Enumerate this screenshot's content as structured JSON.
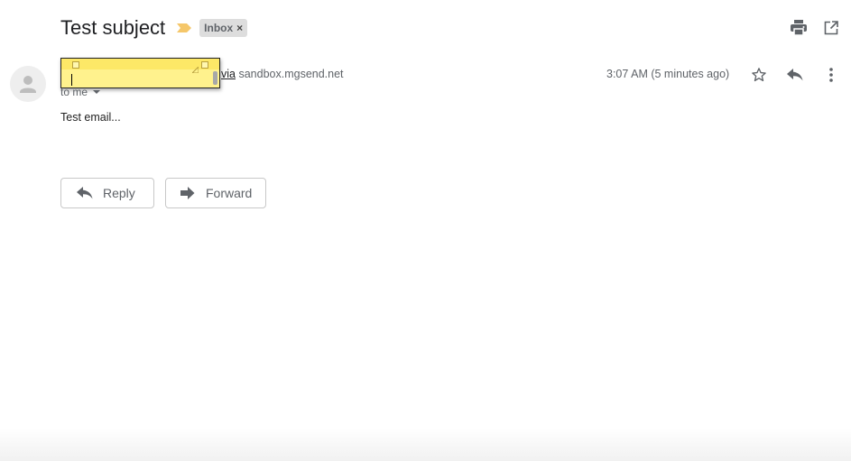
{
  "subject": {
    "title": "Test subject",
    "label": "Inbox",
    "label_remove": "×"
  },
  "toolbar": {
    "print_icon": "print-icon",
    "open_new_window_icon": "open-in-new-icon"
  },
  "sender": {
    "via_word": "via",
    "via_domain": "sandbox.mgsend.net",
    "recipient": "to me",
    "timestamp": "3:07 AM (5 minutes ago)"
  },
  "message": {
    "body": "Test email..."
  },
  "actions": {
    "reply_label": "Reply",
    "forward_label": "Forward"
  },
  "colors": {
    "importance": "#f5c76a",
    "sticky_note": "#fff28d",
    "icon_gray": "#5f6368"
  }
}
